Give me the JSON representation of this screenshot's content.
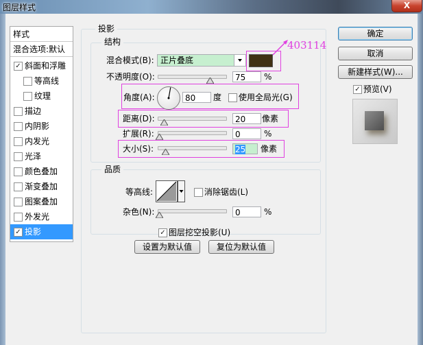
{
  "window": {
    "title": "图层样式",
    "close": "X"
  },
  "left_panel": {
    "items": [
      {
        "label": "样式",
        "checkbox": false,
        "checked": false,
        "selected": false
      },
      {
        "label": "混合选项:默认",
        "checkbox": false,
        "checked": false,
        "selected": false
      },
      {
        "label": "斜面和浮雕",
        "checkbox": true,
        "checked": true,
        "selected": false
      },
      {
        "label": "等高线",
        "checkbox": true,
        "checked": false,
        "selected": false,
        "indent": true
      },
      {
        "label": "纹理",
        "checkbox": true,
        "checked": false,
        "selected": false,
        "indent": true
      },
      {
        "label": "描边",
        "checkbox": true,
        "checked": false,
        "selected": false
      },
      {
        "label": "内阴影",
        "checkbox": true,
        "checked": false,
        "selected": false
      },
      {
        "label": "内发光",
        "checkbox": true,
        "checked": false,
        "selected": false
      },
      {
        "label": "光泽",
        "checkbox": true,
        "checked": false,
        "selected": false
      },
      {
        "label": "颜色叠加",
        "checkbox": true,
        "checked": false,
        "selected": false
      },
      {
        "label": "渐变叠加",
        "checkbox": true,
        "checked": false,
        "selected": false
      },
      {
        "label": "图案叠加",
        "checkbox": true,
        "checked": false,
        "selected": false
      },
      {
        "label": "外发光",
        "checkbox": true,
        "checked": false,
        "selected": false
      },
      {
        "label": "投影",
        "checkbox": true,
        "checked": true,
        "selected": true
      }
    ]
  },
  "main": {
    "section_title": "投影",
    "structure": {
      "title": "结构",
      "blend_mode_label": "混合模式(B):",
      "blend_mode_value": "正片叠底",
      "color_hex": "#403114",
      "color_annotation": "403114",
      "opacity_label": "不透明度(O):",
      "opacity_value": "75",
      "opacity_fraction": 0.75,
      "percent": "%",
      "angle_label": "角度(A):",
      "angle_value": "80",
      "angle_unit": "度",
      "global_light_label": "使用全局光(G)",
      "global_light_checked": false,
      "distance_label": "距离(D):",
      "distance_value": "20",
      "distance_fraction": 0.08,
      "pixels": "像素",
      "spread_label": "扩展(R):",
      "spread_value": "0",
      "spread_fraction": 0.0,
      "size_label": "大小(S):",
      "size_value": "25",
      "size_fraction": 0.1
    },
    "quality": {
      "title": "品质",
      "contour_label": "等高线:",
      "antialias_label": "消除锯齿(L)",
      "antialias_checked": false,
      "noise_label": "杂色(N):",
      "noise_value": "0",
      "noise_fraction": 0.0,
      "percent": "%"
    },
    "knockout_label": "图层挖空投影(U)",
    "knockout_checked": true,
    "set_default_label": "设置为默认值",
    "reset_default_label": "复位为默认值"
  },
  "right": {
    "ok_label": "确定",
    "cancel_label": "取消",
    "new_style_label": "新建样式(W)...",
    "preview_label": "预览(V)",
    "preview_checked": true
  },
  "colors": {
    "highlight": "#e040e0",
    "selection": "#3399ff",
    "field_green": "#c6efcf"
  }
}
